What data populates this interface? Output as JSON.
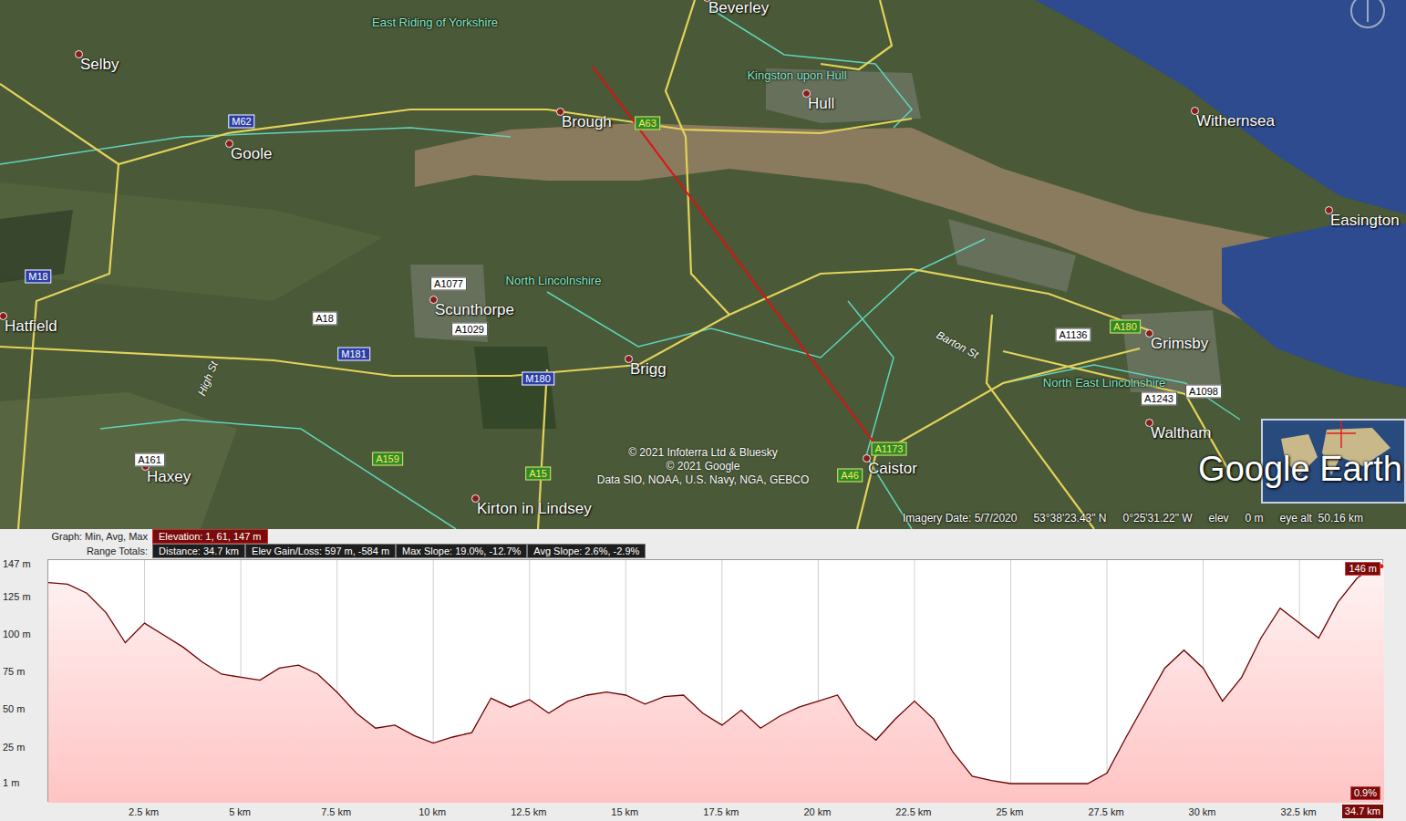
{
  "map": {
    "places": [
      {
        "label": "Beverley",
        "kind": "town"
      },
      {
        "label": "Selby",
        "kind": "town"
      },
      {
        "label": "Goole",
        "kind": "town"
      },
      {
        "label": "Brough",
        "kind": "town"
      },
      {
        "label": "Hull",
        "kind": "town"
      },
      {
        "label": "Withernsea",
        "kind": "town"
      },
      {
        "label": "Easington",
        "kind": "town"
      },
      {
        "label": "Scunthorpe",
        "kind": "town"
      },
      {
        "label": "Hatfield",
        "kind": "town"
      },
      {
        "label": "Brigg",
        "kind": "town"
      },
      {
        "label": "Grimsby",
        "kind": "town"
      },
      {
        "label": "Waltham",
        "kind": "town"
      },
      {
        "label": "Haxey",
        "kind": "town"
      },
      {
        "label": "Kirton in Lindsey",
        "kind": "town"
      },
      {
        "label": "Caistor",
        "kind": "town"
      },
      {
        "label": "East Riding of Yorkshire",
        "kind": "region"
      },
      {
        "label": "Kingston upon Hull",
        "kind": "region"
      },
      {
        "label": "North Lincolnshire",
        "kind": "region"
      },
      {
        "label": "North East Lincolnshire",
        "kind": "region"
      },
      {
        "label": "M62",
        "kind": "motorway"
      },
      {
        "label": "M18",
        "kind": "motorway"
      },
      {
        "label": "M181",
        "kind": "motorway"
      },
      {
        "label": "M180",
        "kind": "motorway"
      },
      {
        "label": "A63",
        "kind": "primary"
      },
      {
        "label": "A159",
        "kind": "primary"
      },
      {
        "label": "A15",
        "kind": "primary"
      },
      {
        "label": "A1173",
        "kind": "primary"
      },
      {
        "label": "A46",
        "kind": "primary"
      },
      {
        "label": "A180",
        "kind": "primary"
      },
      {
        "label": "A1077",
        "kind": "minor"
      },
      {
        "label": "A1029",
        "kind": "minor"
      },
      {
        "label": "A18",
        "kind": "minor"
      },
      {
        "label": "A1136",
        "kind": "minor"
      },
      {
        "label": "A1243",
        "kind": "minor"
      },
      {
        "label": "A1098",
        "kind": "minor"
      },
      {
        "label": "A161",
        "kind": "minor"
      },
      {
        "label": "Barton St",
        "kind": "street"
      },
      {
        "label": "High St",
        "kind": "street"
      }
    ],
    "attribution": [
      "© 2021 Infoterra Ltd & Bluesky",
      "© 2021 Google",
      "Data SIO, NOAA, U.S. Navy, NGA, GEBCO"
    ],
    "logo": "Google Earth"
  },
  "status_bar": {
    "items": [
      "Imagery Date: 5/7/2020",
      "53°38'23.43\" N",
      "0°25'31.22\" W",
      "elev",
      "0 m",
      "eye alt  50.16 km"
    ]
  },
  "profile": {
    "header": {
      "graph_label": "Graph: Min, Avg, Max",
      "graph_value": "Elevation: 1, 61, 147 m",
      "totals_label": "Range Totals:",
      "totals": [
        "Distance: 34.7 km",
        "Elev Gain/Loss: 597 m, -584 m",
        "Max Slope: 19.0%, -12.7%",
        "Avg Slope: 2.6%, -2.9%"
      ]
    },
    "y_ticks": [
      {
        "label": "147 m",
        "value": 147
      },
      {
        "label": "125 m",
        "value": 125
      },
      {
        "label": "100 m",
        "value": 100
      },
      {
        "label": "75 m",
        "value": 75
      },
      {
        "label": "50 m",
        "value": 50
      },
      {
        "label": "25 m",
        "value": 25
      },
      {
        "label": "1 m",
        "value": 1
      }
    ],
    "x_ticks": [
      {
        "label": "2.5 km",
        "value": 2.5
      },
      {
        "label": "5 km",
        "value": 5
      },
      {
        "label": "7.5 km",
        "value": 7.5
      },
      {
        "label": "10 km",
        "value": 10
      },
      {
        "label": "12.5 km",
        "value": 12.5
      },
      {
        "label": "15 km",
        "value": 15
      },
      {
        "label": "17.5 km",
        "value": 17.5
      },
      {
        "label": "20 km",
        "value": 20
      },
      {
        "label": "22.5 km",
        "value": 22.5
      },
      {
        "label": "25 km",
        "value": 25
      },
      {
        "label": "27.5 km",
        "value": 27.5
      },
      {
        "label": "30 km",
        "value": 30
      },
      {
        "label": "32.5 km",
        "value": 32.5
      }
    ],
    "x_max": 34.7,
    "y_min": 1,
    "y_max": 147,
    "series": [
      {
        "x_values": [
          0,
          0.5,
          1,
          1.5,
          2,
          2.5,
          3,
          3.5,
          4,
          4.5,
          5,
          5.5,
          6,
          6.5,
          7,
          7.5,
          8,
          8.5,
          9,
          9.5,
          10,
          10.5,
          11,
          11.5,
          12,
          12.5,
          13,
          13.5,
          14,
          14.5,
          15,
          15.5,
          16,
          16.5,
          17,
          17.5,
          18,
          18.5,
          19,
          19.5,
          20,
          20.5,
          21,
          21.5,
          22,
          22.5,
          23,
          23.5,
          24,
          24.5,
          25,
          25.5,
          26,
          26.5,
          27,
          27.5,
          28,
          28.5,
          29,
          29.5,
          30,
          30.5,
          31,
          31.5,
          32,
          32.5,
          33,
          33.5,
          34,
          34.5,
          34.7
        ],
        "values": [
          135,
          134,
          128,
          115,
          95,
          108,
          100,
          92,
          82,
          74,
          72,
          70,
          78,
          80,
          74,
          62,
          48,
          38,
          40,
          33,
          28,
          32,
          35,
          58,
          52,
          57,
          48,
          56,
          60,
          62,
          60,
          54,
          59,
          60,
          48,
          40,
          50,
          38,
          46,
          52,
          56,
          60,
          40,
          30,
          44,
          56,
          44,
          22,
          6,
          3,
          1,
          1,
          1,
          1,
          1,
          8,
          32,
          55,
          78,
          90,
          78,
          56,
          72,
          98,
          118,
          108,
          98,
          122,
          138,
          147,
          146
        ]
      }
    ],
    "cursor": {
      "elevation": "146 m",
      "slope": "0.9%",
      "distance": "34.7 km"
    }
  }
}
